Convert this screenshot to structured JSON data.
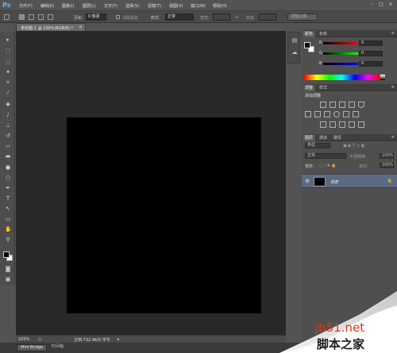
{
  "app": {
    "logo": "Ps"
  },
  "menu": {
    "items": [
      "文件(F)",
      "编辑(E)",
      "图像(I)",
      "图层(L)",
      "文字(Y)",
      "选择(S)",
      "滤镜(T)",
      "视图(V)",
      "窗口(W)",
      "帮助(H)"
    ],
    "window_controls": [
      "–",
      "□",
      "×"
    ]
  },
  "options_bar": {
    "feather_label": "羽化:",
    "feather_value": "0 像素",
    "antialias_label": "消除锯齿",
    "style_label": "样式:",
    "style_value": "正常",
    "width_label": "宽度:",
    "height_label": "高度:",
    "refine_edge_label": "调整边缘..."
  },
  "document": {
    "tab_label": "未标题-1 @ 100%(RGB/8) *",
    "close_glyph": "×"
  },
  "status_bar": {
    "zoom": "100%",
    "doc_info": "文档:732.4K/0 字节"
  },
  "bottom_bar": {
    "mini_bridge": "Mini Bridge",
    "timeline": "时间轴"
  },
  "toolbox": {
    "tools": [
      {
        "name": "move-tool-icon",
        "glyph": "▸"
      },
      {
        "name": "marquee-tool-icon",
        "glyph": "⬚"
      },
      {
        "name": "lasso-tool-icon",
        "glyph": "◌"
      },
      {
        "name": "quick-select-tool-icon",
        "glyph": "✦"
      },
      {
        "name": "crop-tool-icon",
        "glyph": "⌗"
      },
      {
        "name": "eyedropper-tool-icon",
        "glyph": "⁄"
      },
      {
        "name": "healing-brush-tool-icon",
        "glyph": "✚"
      },
      {
        "name": "brush-tool-icon",
        "glyph": "∕"
      },
      {
        "name": "clone-stamp-tool-icon",
        "glyph": "⊥"
      },
      {
        "name": "history-brush-tool-icon",
        "glyph": "↺"
      },
      {
        "name": "eraser-tool-icon",
        "glyph": "▱"
      },
      {
        "name": "gradient-tool-icon",
        "glyph": "▬"
      },
      {
        "name": "blur-tool-icon",
        "glyph": "●"
      },
      {
        "name": "dodge-tool-icon",
        "glyph": "○"
      },
      {
        "name": "pen-tool-icon",
        "glyph": "✒"
      },
      {
        "name": "type-tool-icon",
        "glyph": "T"
      },
      {
        "name": "path-select-tool-icon",
        "glyph": "↖"
      },
      {
        "name": "shape-tool-icon",
        "glyph": "▭"
      },
      {
        "name": "hand-tool-icon",
        "glyph": "✋"
      },
      {
        "name": "zoom-tool-icon",
        "glyph": "⚲"
      }
    ],
    "quick_mask_glyph": "◙",
    "screen_mode_glyph": "▣"
  },
  "dock": {
    "icons": [
      {
        "name": "history-panel-icon",
        "glyph": "▤"
      },
      {
        "name": "actions-panel-icon",
        "glyph": "☁"
      }
    ]
  },
  "color_panel": {
    "tabs": [
      "颜色",
      "色板"
    ],
    "channels": [
      {
        "label": "R",
        "value": "0",
        "color": "#cc2222"
      },
      {
        "label": "G",
        "value": "0",
        "color": "#22aa22"
      },
      {
        "label": "B",
        "value": "0",
        "color": "#2255cc"
      }
    ],
    "menu_glyph": "≡"
  },
  "adjustments_panel": {
    "tabs": [
      "调整",
      "样式"
    ],
    "title": "添加调整",
    "menu_glyph": "≡"
  },
  "layers_panel": {
    "tabs": [
      "图层",
      "通道",
      "路径"
    ],
    "filter_label": "类型",
    "blend_mode": "正常",
    "opacity_label": "不透明度:",
    "opacity_value": "100%",
    "lock_label": "锁定:",
    "fill_label": "填充:",
    "fill_value": "100%",
    "layers": [
      {
        "name": "背景",
        "visible_glyph": "👁",
        "lock_glyph": "🔒"
      }
    ],
    "menu_glyph": "≡"
  },
  "watermark": {
    "site": "jb51.net",
    "title": "脚本之家"
  }
}
